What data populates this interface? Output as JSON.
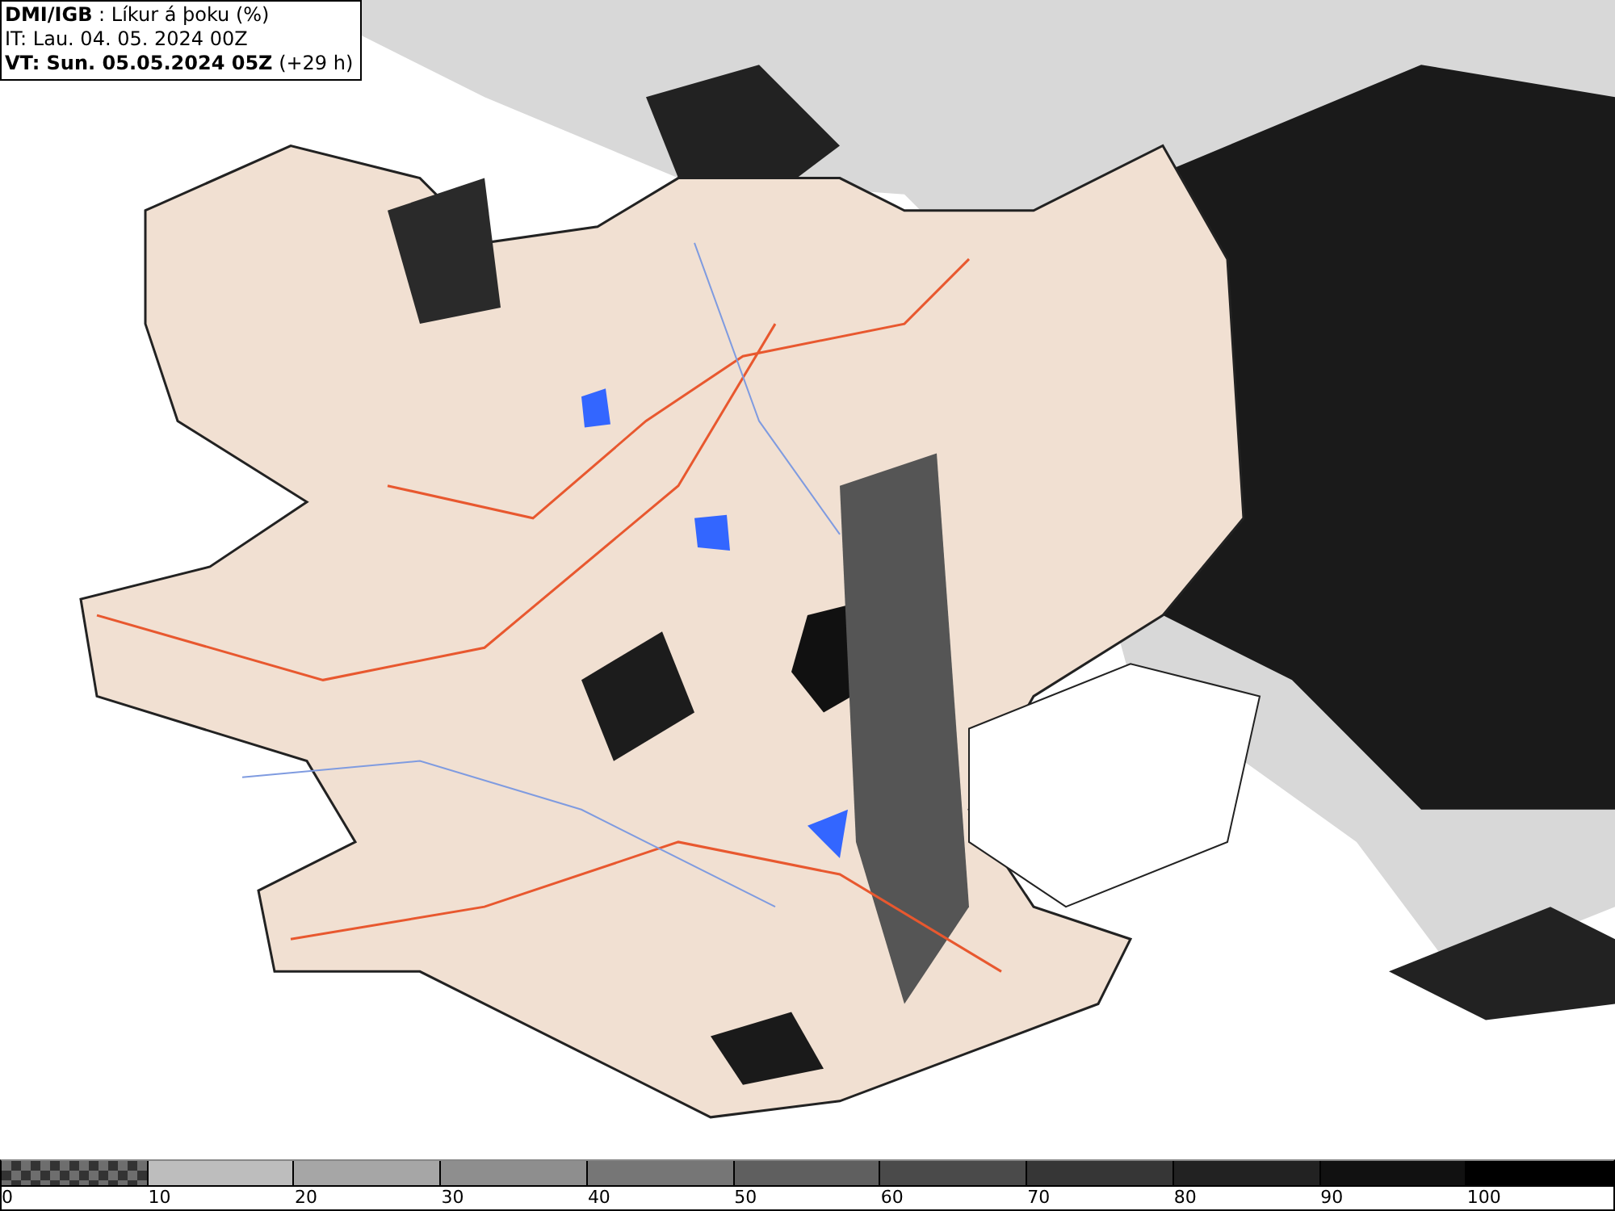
{
  "header": {
    "lines": [
      "**DMI/IGB** : Líkur á þoku (%)",
      "IT: Lau. 04. 05. 2024 00Z",
      "**VT: Sun. 05.05.2024 05Z** (+29 h)"
    ]
  },
  "legend": {
    "bins": [
      {
        "kind": "checker",
        "color": "#6e6e6e",
        "label": "0"
      },
      {
        "kind": "solid",
        "color": "#bdbdbd",
        "label": "10"
      },
      {
        "kind": "solid",
        "color": "#a6a6a6",
        "label": "20"
      },
      {
        "kind": "solid",
        "color": "#8e8e8e",
        "label": "30"
      },
      {
        "kind": "solid",
        "color": "#767676",
        "label": "40"
      },
      {
        "kind": "solid",
        "color": "#5f5f5f",
        "label": "50"
      },
      {
        "kind": "solid",
        "color": "#4a4a4a",
        "label": "60"
      },
      {
        "kind": "solid",
        "color": "#363636",
        "label": "70"
      },
      {
        "kind": "solid",
        "color": "#222222",
        "label": "80"
      },
      {
        "kind": "solid",
        "color": "#111111",
        "label": "90"
      },
      {
        "kind": "solid",
        "color": "#000000",
        "label": "100"
      }
    ]
  }
}
